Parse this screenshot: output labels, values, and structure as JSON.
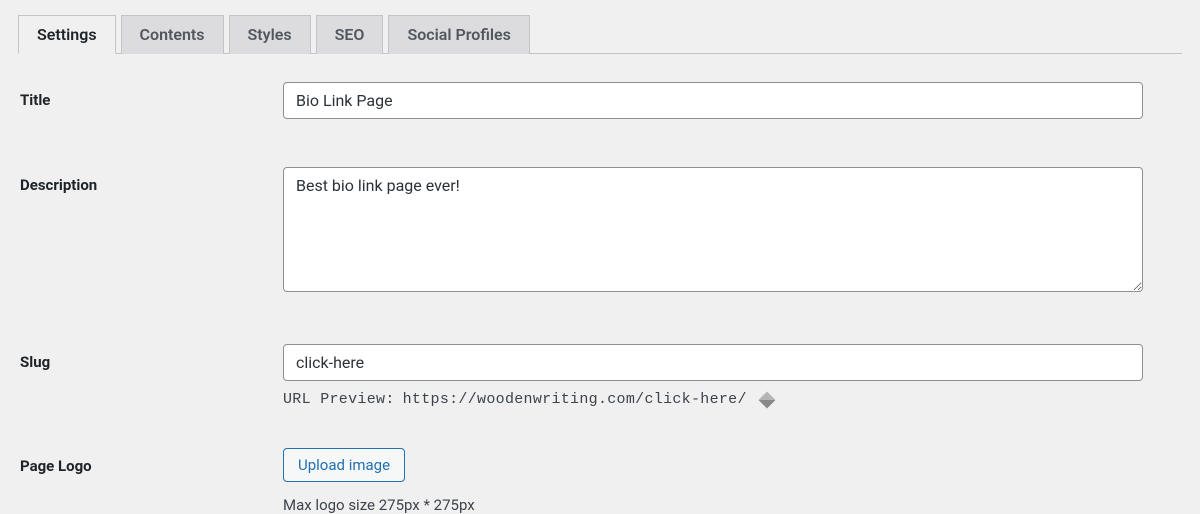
{
  "tabs": {
    "settings": "Settings",
    "contents": "Contents",
    "styles": "Styles",
    "seo": "SEO",
    "social": "Social Profiles"
  },
  "fields": {
    "title": {
      "label": "Title",
      "value": "Bio Link Page"
    },
    "description": {
      "label": "Description",
      "value": "Best bio link page ever!"
    },
    "slug": {
      "label": "Slug",
      "value": "click-here",
      "preview_label": "URL Preview:",
      "preview_url": "https://woodenwriting.com/click-here/"
    },
    "logo": {
      "label": "Page Logo",
      "button": "Upload image",
      "hint": "Max logo size 275px * 275px"
    }
  }
}
